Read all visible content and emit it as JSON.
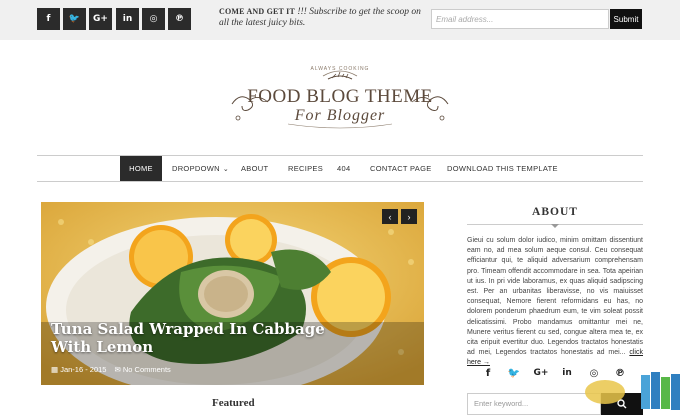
{
  "topbar": {
    "social": [
      {
        "icon": "facebook-icon",
        "glyph": "f"
      },
      {
        "icon": "twitter-icon",
        "glyph": "🐦"
      },
      {
        "icon": "google-plus-icon",
        "glyph": "G+"
      },
      {
        "icon": "linkedin-icon",
        "glyph": "in"
      },
      {
        "icon": "instagram-icon",
        "glyph": "◎"
      },
      {
        "icon": "pinterest-icon",
        "glyph": "℗"
      }
    ],
    "subscribe_lead": "COME AND GET IT",
    "subscribe_bang": "!!!",
    "subscribe_text": "Subscribe to get the scoop on all the latest juicy bits.",
    "email_placeholder": "Email address...",
    "submit_label": "Submit"
  },
  "logo": {
    "tagline": "ALWAYS COOKING",
    "title": "FOOD BLOG THEME",
    "subtitle": "For Blogger"
  },
  "nav": {
    "items": [
      "HOME",
      "DROPDOWN",
      "ABOUT",
      "RECIPES",
      "404",
      "CONTACT PAGE",
      "DOWNLOAD THIS TEMPLATE"
    ],
    "active": "HOME"
  },
  "hero": {
    "title": "Tuna Salad Wrapped In Cabbage With Lemon",
    "date": "Jan-16 - 2015",
    "comments": "No Comments",
    "prev": "‹",
    "next": "›"
  },
  "featured_label": "Featured",
  "sidebar": {
    "about_title": "ABOUT",
    "about_text": "Gieui cu solum dolor iudico, minim omittam dissentiunt eam no, ad mea solum aeque consul. Ceu consequat efficiantur qui, te aliquid adversarium comprehensam pro. Timeam offendit accommodare in sea. Tota apeirian ut ius. In pri vide laboramus, ex quas aliquid sadipscing est. Per an urbanitas liberavisse, no vis maiuisset consequat, Nemore fierent reformidans eu has, no dolorem ponderum phaedrum eum, te vim soleat possit delicatissimi. Probo mandamus omittantur mei ne, Munere veritus fierent cu sed, congue altera mea te, ex cita eripuit evertitur duo. Legendos tractatos honestatis ad mei, Legendos tractatos honestatis ad mei...",
    "click_here": "click here →",
    "social": [
      {
        "icon": "facebook-icon",
        "glyph": "f"
      },
      {
        "icon": "twitter-icon",
        "glyph": "🐦"
      },
      {
        "icon": "google-plus-icon",
        "glyph": "G+"
      },
      {
        "icon": "linkedin-icon",
        "glyph": "in"
      },
      {
        "icon": "instagram-icon",
        "glyph": "◎"
      },
      {
        "icon": "pinterest-icon",
        "glyph": "℗"
      }
    ],
    "search_placeholder": "Enter keyword..."
  }
}
